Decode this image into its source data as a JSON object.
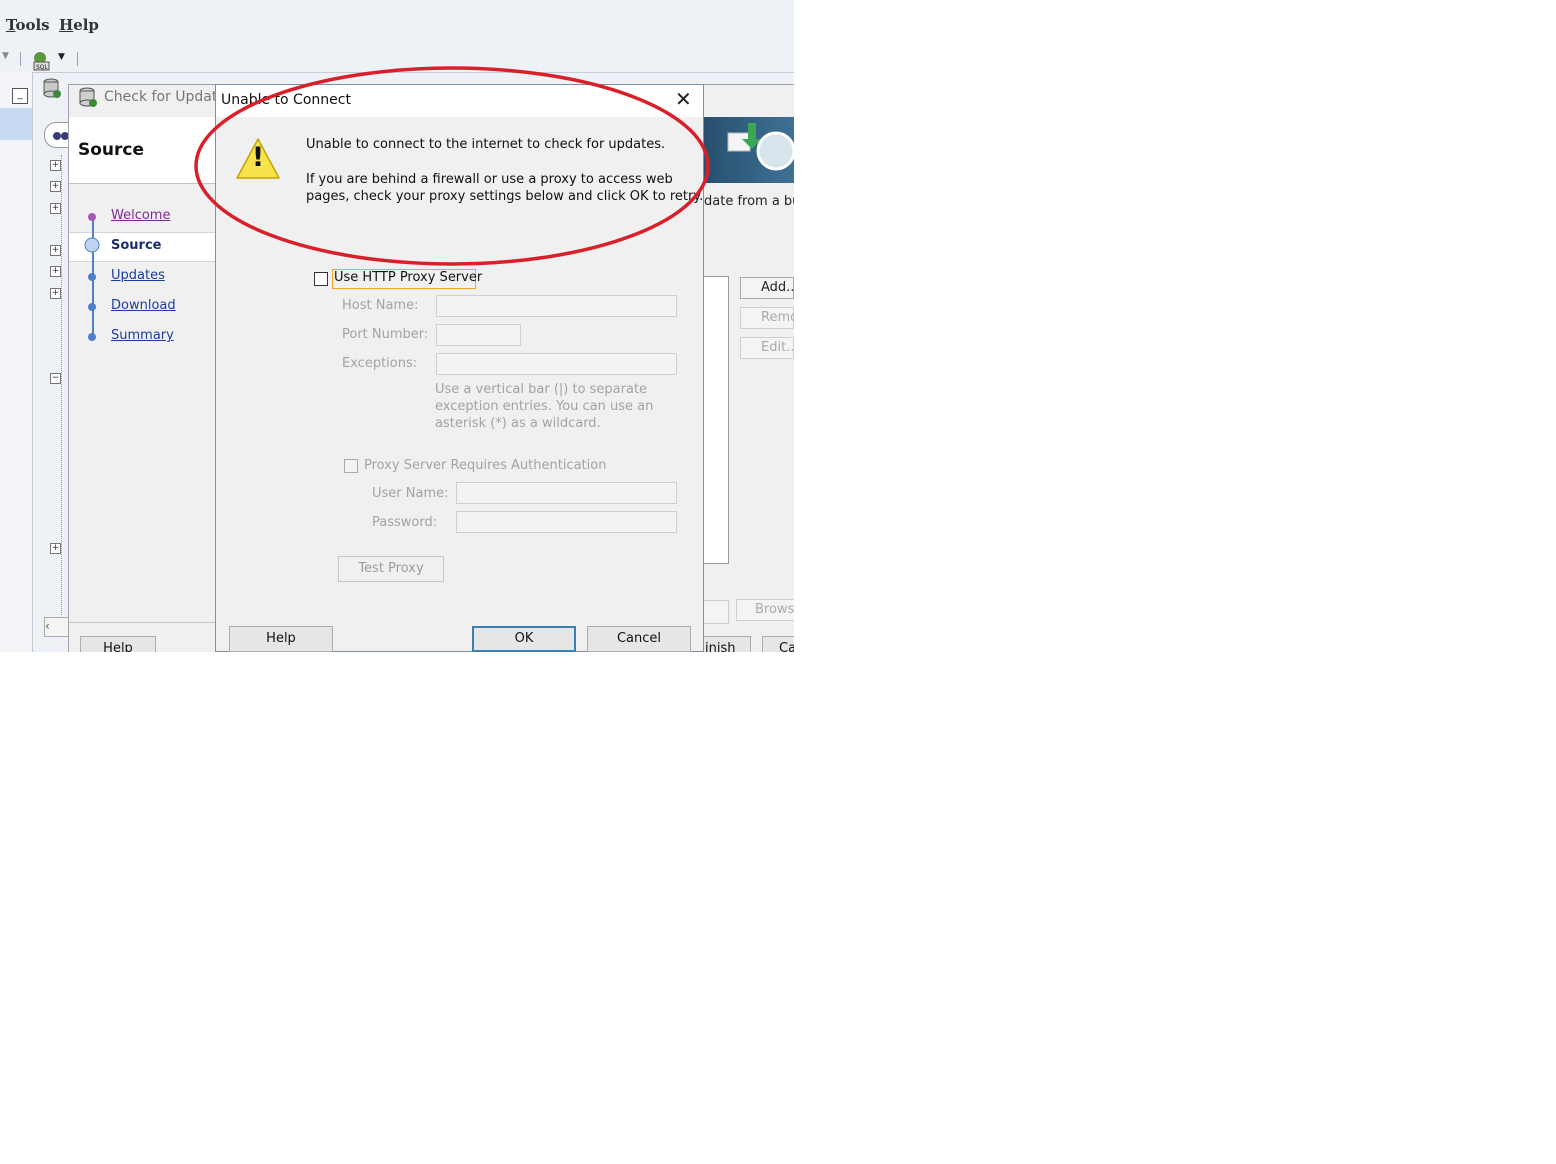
{
  "menubar": {
    "items": [
      "Tools",
      "Help"
    ]
  },
  "wizard": {
    "title": "Check for Updates",
    "header": "Source",
    "banner_text": "date from a bun",
    "nav": [
      {
        "label": "Welcome"
      },
      {
        "label": "Source"
      },
      {
        "label": "Updates"
      },
      {
        "label": "Download"
      },
      {
        "label": "Summary"
      }
    ],
    "side_buttons": [
      "Add...",
      "Remo",
      "Edit..."
    ],
    "browse_label": "Browse",
    "help_label": "Help",
    "finish_label": "inish",
    "cancel_label": "Ca"
  },
  "dialog": {
    "title": "Unable to Connect",
    "close_glyph": "✕",
    "warning_glyph": "!",
    "message_1": "Unable to connect to the internet to check for updates.",
    "message_2": " If you are behind a firewall or use a proxy to access web\npages, check your proxy settings below and click OK to retry.",
    "use_proxy_label": "Use HTTP Proxy Server",
    "host_label": "Host Name:",
    "port_label": "Port Number:",
    "exceptions_label": "Exceptions:",
    "hint": "Use a vertical bar (|) to separate exception entries.  You can use an asterisk (*) as a wildcard.",
    "auth_label": "Proxy Server Requires Authentication",
    "user_label": "User Name:",
    "password_label": "Password:",
    "test_proxy_label": "Test Proxy",
    "help_label": "Help",
    "ok_label": "OK",
    "cancel_label": "Cancel"
  },
  "colors": {
    "annotation_ellipse": "#d9202a",
    "link": "#1a3d9e",
    "visited_link": "#7b2b8c"
  }
}
